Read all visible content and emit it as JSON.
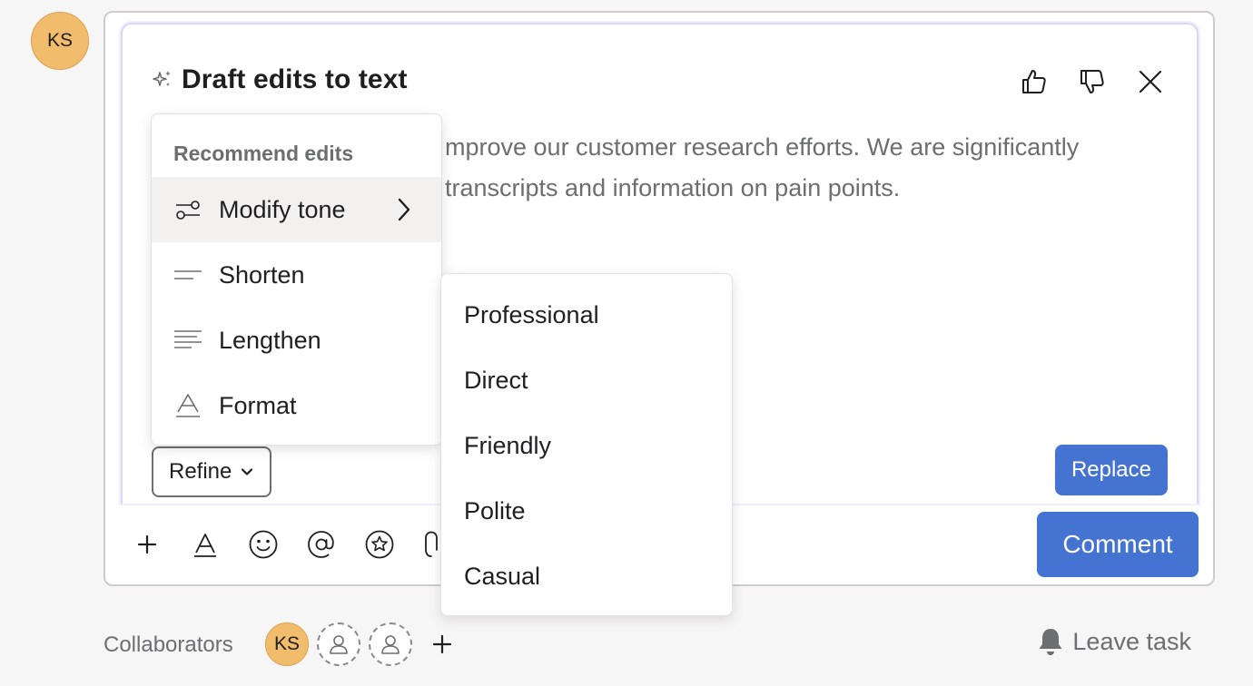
{
  "user": {
    "initials": "KS",
    "color": "#f1bd6c"
  },
  "ai_panel": {
    "title": "Draft edits to text",
    "title_icon": "sparkle-icon",
    "actions": [
      "thumbs-up-icon",
      "thumbs-down-icon",
      "close-icon"
    ],
    "draft_lines": [
      "mprove our customer research efforts. We are significantly",
      "transcripts and information on pain points."
    ],
    "refine_label": "Refine",
    "replace_label": "Replace"
  },
  "recommend_menu": {
    "heading": "Recommend edits",
    "items": [
      {
        "label": "Modify tone",
        "icon": "sliders-icon",
        "has_submenu": true
      },
      {
        "label": "Shorten",
        "icon": "shorten-icon"
      },
      {
        "label": "Lengthen",
        "icon": "lengthen-icon"
      },
      {
        "label": "Format",
        "icon": "format-icon"
      }
    ]
  },
  "tone_menu": {
    "items": [
      "Professional",
      "Direct",
      "Friendly",
      "Polite",
      "Casual"
    ]
  },
  "toolbar": {
    "tools": [
      "plus-icon",
      "text-format-icon",
      "emoji-icon",
      "mention-icon",
      "star-icon",
      "attachment-icon"
    ],
    "comment_label": "Comment"
  },
  "footer": {
    "collaborators_label": "Collaborators",
    "collaborator_initials": "KS",
    "leave_task_label": "Leave task"
  },
  "colors": {
    "accent": "#4573d2",
    "avatar": "#f1bd6c",
    "ai_border": "#ddd6fb"
  }
}
